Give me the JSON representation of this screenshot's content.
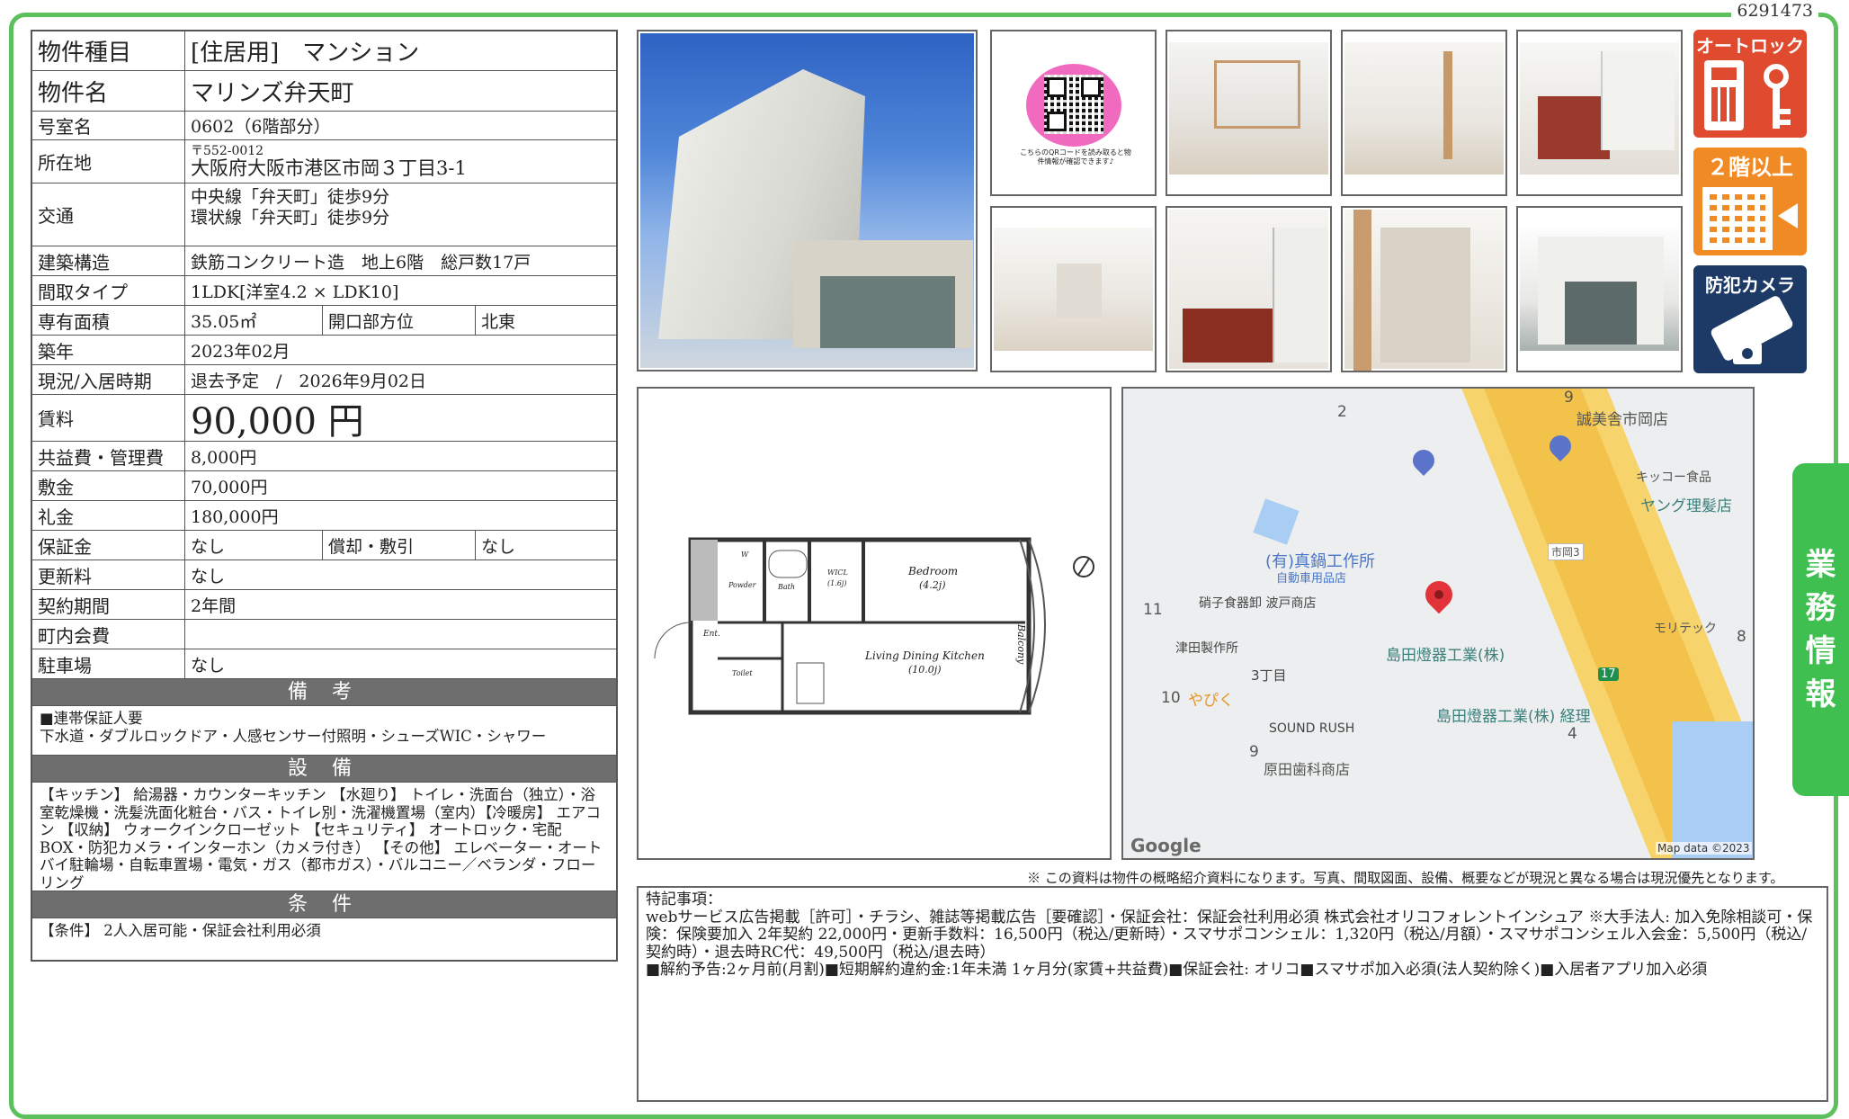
{
  "doc_id": "6291473",
  "property": {
    "type_label": "物件種目",
    "type_value": "[住居用]　マンション",
    "name_label": "物件名",
    "name_value": "マリンズ弁天町",
    "room_label": "号室名",
    "room_value": "0602（6階部分）",
    "address_label": "所在地",
    "postal": "〒552-0012",
    "address": "大阪府大阪市港区市岡３丁目3-1",
    "transport_label": "交通",
    "transport_1": "中央線「弁天町」徒歩9分",
    "transport_2": "環状線「弁天町」徒歩9分",
    "structure_label": "建築構造",
    "structure_value": "鉄筋コンクリート造　地上6階　総戸数17戸",
    "layout_label": "間取タイプ",
    "layout_value": "1LDK[洋室4.2 × LDK10]",
    "area_label": "専有面積",
    "area_value": "35.05㎡",
    "opening_label": "開口部方位",
    "opening_value": "北東",
    "built_label": "築年",
    "built_value": "2023年02月",
    "status_label": "現況/入居時期",
    "status_value": "退去予定　/　2026年9月02日",
    "rent_label": "賃料",
    "rent_value": "90,000 円",
    "common_label": "共益費・管理費",
    "common_value": "8,000円",
    "deposit_label": "敷金",
    "deposit_value": "70,000円",
    "key_money_label": "礼金",
    "key_money_value": "180,000円",
    "guarantee_label": "保証金",
    "guarantee_value": "なし",
    "amort_label": "償却・敷引",
    "amort_value": "なし",
    "renewal_label": "更新料",
    "renewal_value": "なし",
    "term_label": "契約期間",
    "term_value": "2年間",
    "association_label": "町内会費",
    "association_value": "",
    "parking_label": "駐車場",
    "parking_value": "なし"
  },
  "notes": {
    "header": "備 考",
    "line1": "■連帯保証人要",
    "line2": "下水道・ダブルロックドア・人感センサー付照明・シューズWIC・シャワー"
  },
  "equipment": {
    "header": "設 備",
    "text": "【キッチン】 給湯器・カウンターキッチン 【水廻り】 トイレ・洗面台（独立）・浴室乾燥機・洗髪洗面化粧台・バス・トイレ別・洗濯機置場（室内）【冷暖房】 エアコン 【収納】 ウォークインクローゼット 【セキュリティ】 オートロック・宅配BOX・防犯カメラ・インターホン（カメラ付き） 【その他】 エレベーター・オートバイ駐輪場・自転車置場・電気・ガス（都市ガス）・バルコニー／ベランダ・フローリング"
  },
  "conditions": {
    "header": "条 件",
    "text": "【条件】 2人入居可能・保証会社利用必須"
  },
  "qr_caption": "こちらのQRコードを読み取ると物件情報が確認できます♪",
  "badges": {
    "autolock": "オートロック",
    "second_floor": "２階以上",
    "camera": "防犯カメラ"
  },
  "side_tab": [
    "業",
    "務",
    "情",
    "報"
  ],
  "floorplan": {
    "bedroom": "Bedroom",
    "bedroom_size": "(4.2j)",
    "ldk": "Living Dining Kitchen",
    "ldk_size": "(10.0j)",
    "balcony": "Balcony",
    "wic": "WICL",
    "wic_size": "(1.6j)",
    "bath": "Bath",
    "powder": "Powder",
    "ent": "Ent.",
    "toilet": "Toilet",
    "w": "W"
  },
  "map": {
    "labels": [
      "誠美舎市岡店",
      "キッコー食品",
      "ヤング理髪店",
      "(有)真鍋工作所",
      "自動車用品店",
      "硝子食器卸 波戸商店",
      "津田製作所",
      "3丁目",
      "やぴく",
      "SOUND RUSH",
      "原田歯科商店",
      "島田燈器工業(株)",
      "島田燈器工業(株) 経理",
      "モリテック",
      "市岡3"
    ],
    "numbers": [
      "2",
      "9",
      "11",
      "10",
      "9",
      "4",
      "8",
      "17"
    ],
    "google": "Google",
    "credit": "Map data ©2023"
  },
  "disclaimer": "※ この資料は物件の概略紹介資料になります。写真、間取図面、設備、概要などが現況と異なる場合は現況優先となります。",
  "remarks": {
    "title": "特記事項：",
    "line1": "webサービス広告掲載［許可］・チラシ、雑誌等掲載広告［要確認］・保証会社：保証会社利用必須 株式会社オリコフォレントインシュア ※大手法人: 加入免除相談可・保険：保険要加入 2年契約 22,000円・更新手数料：16,500円（税込/更新時）・スマサポコンシェル：1,320円（税込/月額）・スマサポコンシェル入会金：5,500円（税込/契約時）・退去時RC代：49,500円（税込/退去時）",
    "line2": "■解約予告:2ヶ月前(月割)■短期解約違約金:1年未満 1ヶ月分(家賃+共益費)■保証会社: オリコ■スマサポ加入必須(法人契約除く)■入居者アプリ加入必須"
  },
  "colors": {
    "frame_green": "#5cc05c",
    "tab_green": "#3fbf4f",
    "section_gray": "#6e6e6e",
    "badge_red": "#e04a2f",
    "badge_orange": "#f08a24",
    "badge_navy": "#1d3a66",
    "pin_red": "#e2333a"
  }
}
